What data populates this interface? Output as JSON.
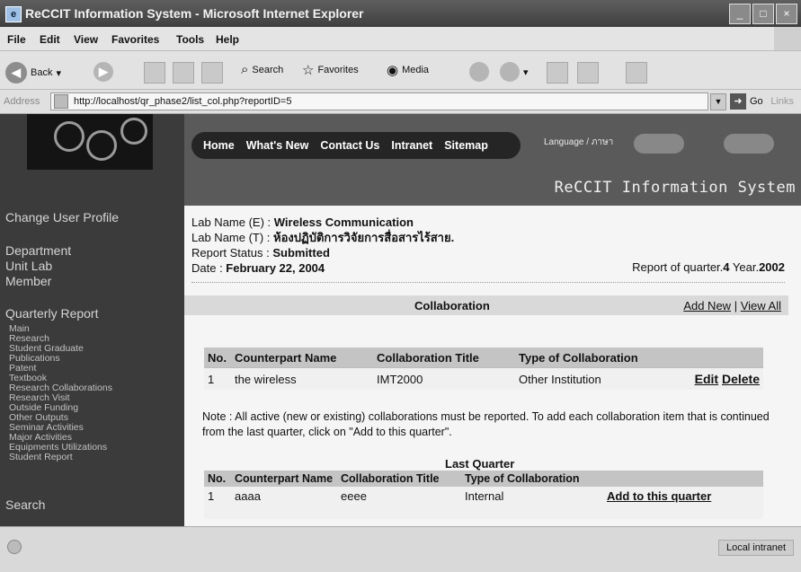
{
  "window": {
    "title": "ReCCIT Information System - Microsoft Internet Explorer"
  },
  "menu": [
    "File",
    "Edit",
    "View",
    "Favorites",
    "Tools",
    "Help"
  ],
  "toolbar": {
    "back": "Back",
    "search": "Search",
    "favorites": "Favorites",
    "media": "Media"
  },
  "address": {
    "label": "Address",
    "url": "http://localhost/qr_phase2/list_col.php?reportID=5",
    "go": "Go",
    "links": "Links"
  },
  "nav": [
    "Home",
    "What's New",
    "Contact Us",
    "Intranet",
    "Sitemap"
  ],
  "language": "Language / ภาษา",
  "system_name": "ReCCIT Information System",
  "sidebar": {
    "change_profile": "Change User Profile",
    "department": "Department",
    "unit_lab": "Unit Lab",
    "member": "Member",
    "quarterly_report": "Quarterly Report",
    "report_items": [
      "Main",
      "Research",
      "Student Graduate",
      "Publications",
      "Patent",
      "Textbook",
      "Research Collaborations",
      "Research Visit",
      "Outside Funding",
      "Other Outputs",
      "Seminar Activities",
      "Major Activities",
      "Equipments Utilizations",
      "Student Report"
    ],
    "search": "Search"
  },
  "report": {
    "lab_name_e_label": "Lab Name (E) : ",
    "lab_name_e": "Wireless Communication",
    "lab_name_t_label": "Lab Name (T) : ",
    "lab_name_t": "ห้องปฏิบัติการวิจัยการสื่อสารไร้สาย.",
    "status_label": "Report Status : ",
    "status": "Submitted",
    "date_label": "Date : ",
    "date": "February 22, 2004",
    "quarter_label": "Report of quarter.",
    "quarter": "4",
    "year_label": "Year.",
    "year": "2002"
  },
  "section": {
    "title": "Collaboration",
    "add_new": "Add New",
    "separator": "|",
    "view_all": "View All"
  },
  "table": {
    "headers": [
      "No.",
      "Counterpart Name",
      "Collaboration Title",
      "Type of Collaboration"
    ],
    "rows": [
      {
        "no": "1",
        "name": "the wireless",
        "title": "IMT2000",
        "type": "Other Institution",
        "edit": "Edit",
        "delete": "Delete"
      }
    ]
  },
  "note": "Note : All active (new or existing) collaborations must be reported. To add each collaboration item that is continued from the last quarter, click on \"Add to this quarter\".",
  "last_quarter": {
    "title": "Last Quarter",
    "headers": [
      "No.",
      "Counterpart Name",
      "Collaboration Title",
      "Type of Collaboration"
    ],
    "rows": [
      {
        "no": "1",
        "name": "aaaa",
        "title": "eeee",
        "type": "Internal",
        "action": "Add to this quarter"
      }
    ]
  },
  "status": {
    "zone": "Local intranet"
  }
}
